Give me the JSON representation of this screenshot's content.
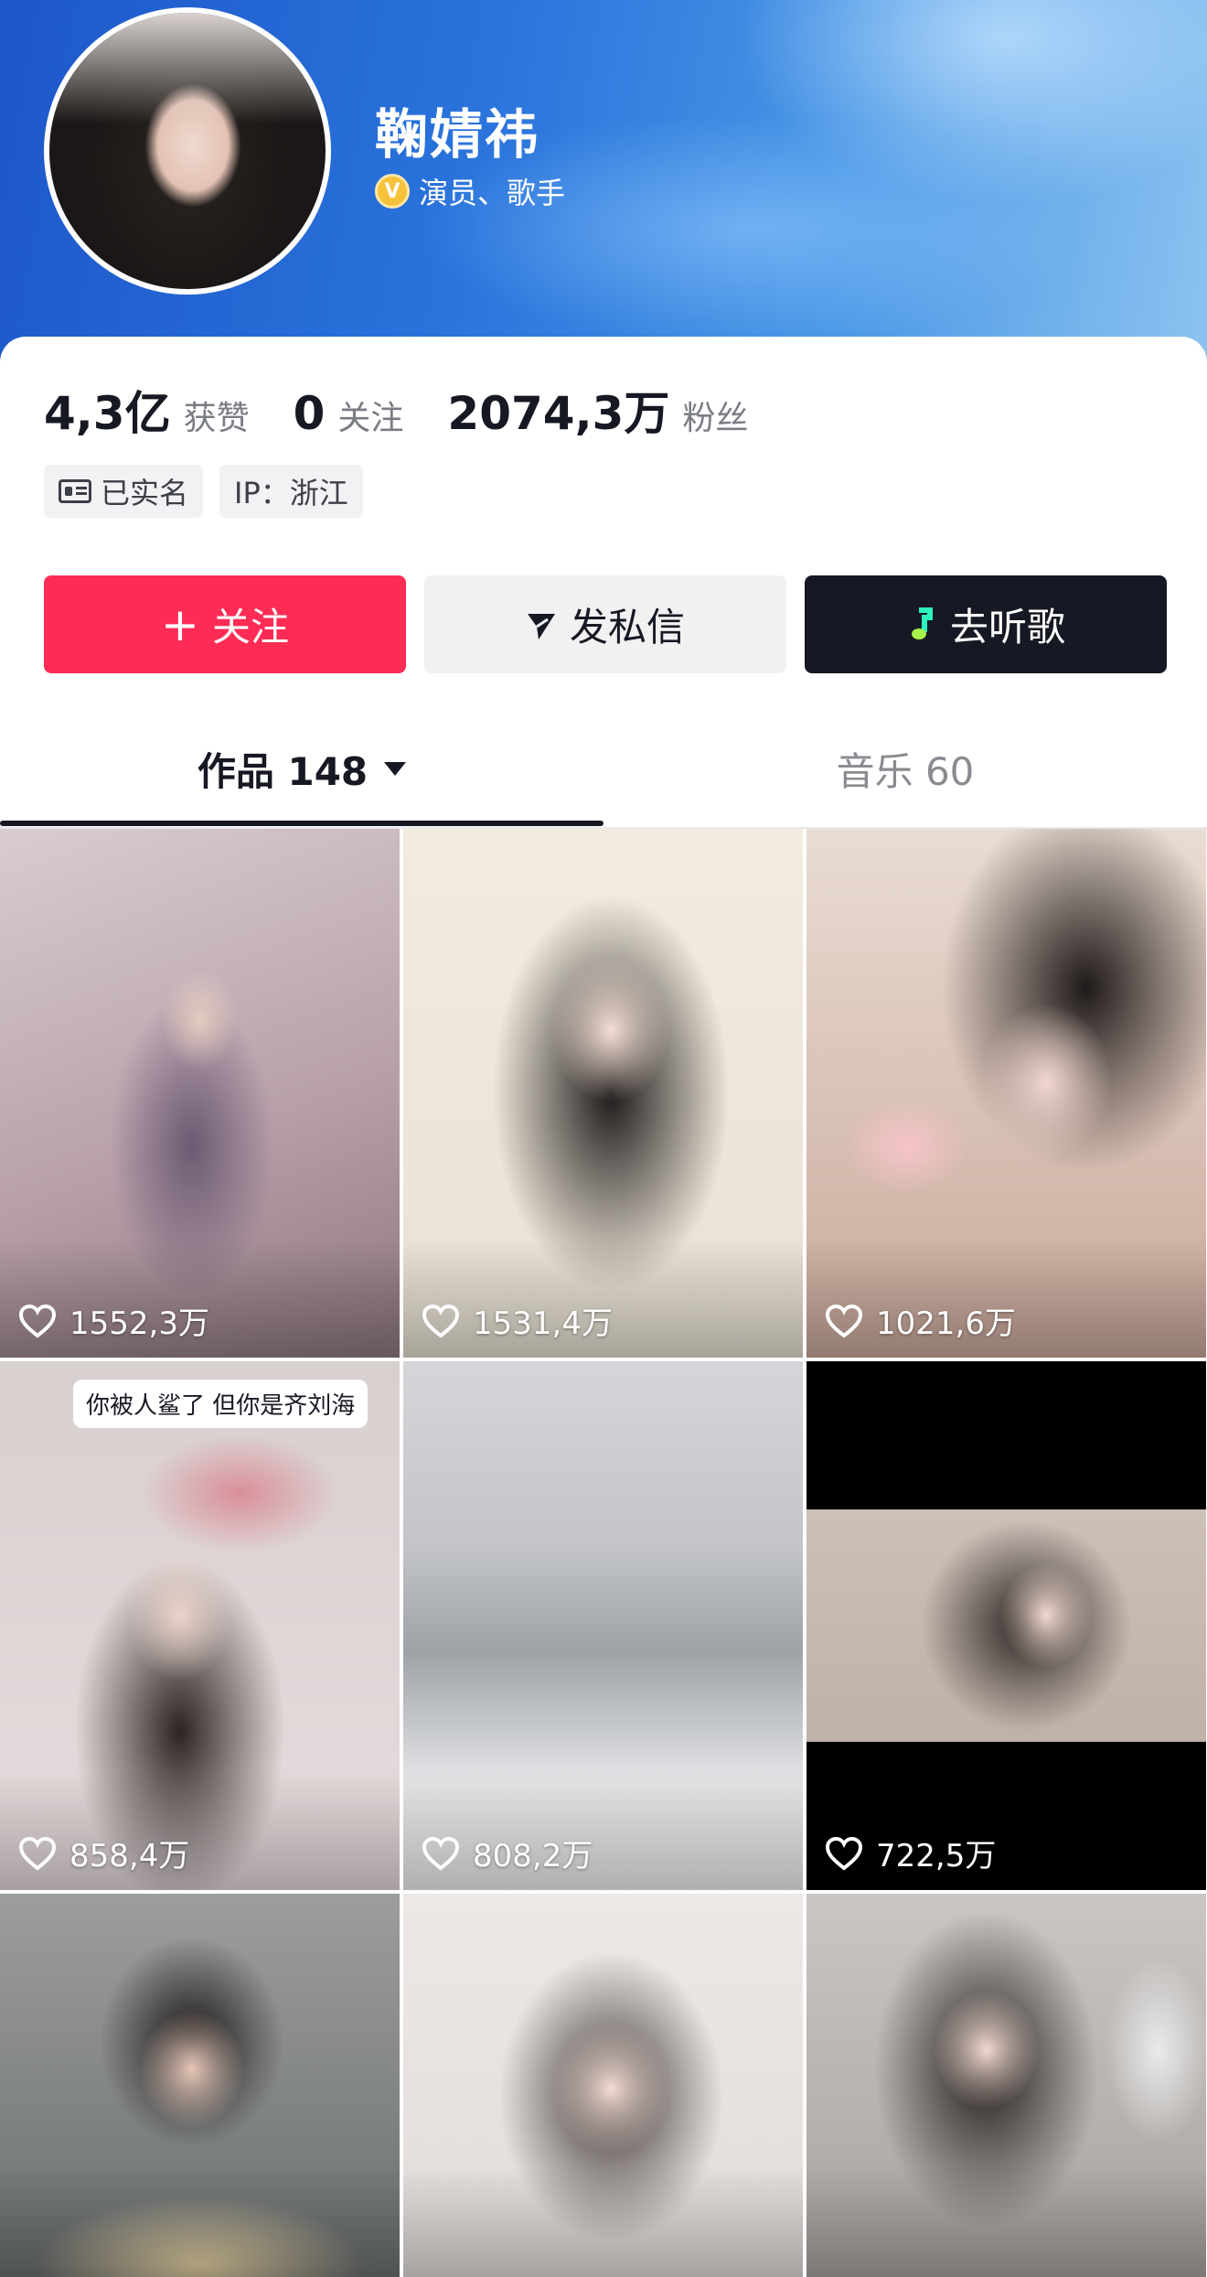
{
  "profile": {
    "name": "鞠婧祎",
    "verify_badge": "V",
    "verify_text": "演员、歌手"
  },
  "stats": [
    {
      "value": "4,3亿",
      "label": "获赞"
    },
    {
      "value": "0",
      "label": "关注"
    },
    {
      "value": "2074,3万",
      "label": "粉丝"
    }
  ],
  "tags": {
    "realname": "已实名",
    "ip": "IP：浙江"
  },
  "actions": {
    "follow": "关注",
    "message": "发私信",
    "music": "去听歌"
  },
  "tabs": {
    "works_label": "作品 148",
    "music_label": "音乐 60"
  },
  "videos": [
    {
      "likes": "1552,3万"
    },
    {
      "likes": "1531,4万"
    },
    {
      "likes": "1021,6万"
    },
    {
      "likes": "858,4万",
      "caption": "你被人鲨了 但你是齐刘海"
    },
    {
      "likes": "808,2万"
    },
    {
      "likes": "722,5万"
    }
  ],
  "colors": {
    "follow": "#fe2c55",
    "music_button": "#161823",
    "banner": "#2a74dc"
  },
  "icons": [
    "verified-icon",
    "id-card-icon",
    "plus-icon",
    "send-icon",
    "music-note-icon",
    "caret-down-icon",
    "heart-icon"
  ]
}
